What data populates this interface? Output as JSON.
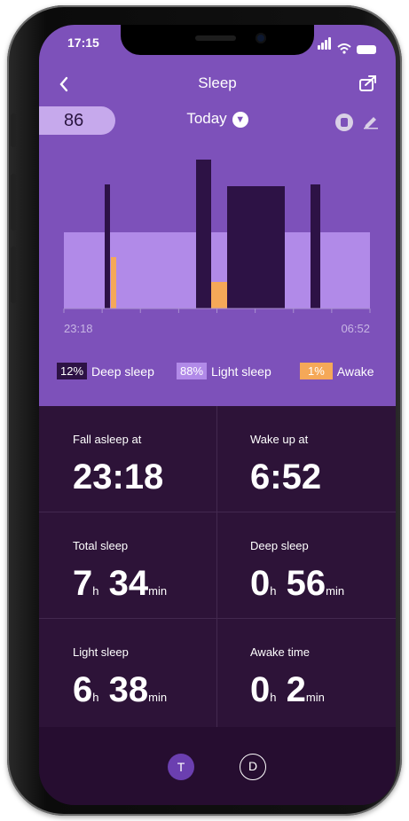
{
  "status": {
    "time": "17:15"
  },
  "header": {
    "title": "Sleep"
  },
  "score": "86",
  "date_selector": {
    "label": "Today"
  },
  "chart": {
    "start_label": "23:18",
    "end_label": "06:52"
  },
  "chart_data": {
    "type": "timeline",
    "start": "23:18",
    "end": "06:52",
    "stages": [
      "Light",
      "Deep",
      "Light",
      "Awake",
      "Light",
      "Deep",
      "Awake",
      "Deep",
      "Light",
      "Deep",
      "Light"
    ],
    "colors": {
      "deep": "#2d1245",
      "light": "#b18ae8",
      "awake": "#f5a858"
    }
  },
  "legend": [
    {
      "pct": "12%",
      "name": "Deep sleep",
      "color": "#2d1245"
    },
    {
      "pct": "88%",
      "name": "Light sleep",
      "color": "#b18ae8"
    },
    {
      "pct": "1%",
      "name": "Awake",
      "color": "#f5a858"
    }
  ],
  "stats": {
    "fall_asleep": {
      "label": "Fall asleep at",
      "value": "23:18"
    },
    "wake_up": {
      "label": "Wake up at",
      "value": "6:52"
    },
    "total_sleep": {
      "label": "Total sleep",
      "h": "7",
      "h_unit": "h",
      "m": "34",
      "m_unit": "min"
    },
    "deep_sleep": {
      "label": "Deep sleep",
      "h": "0",
      "h_unit": "h",
      "m": "56",
      "m_unit": "min"
    },
    "light_sleep": {
      "label": "Light sleep",
      "h": "6",
      "h_unit": "h",
      "m": "38",
      "m_unit": "min"
    },
    "awake_time": {
      "label": "Awake time",
      "h": "0",
      "h_unit": "h",
      "m": "2",
      "m_unit": "min"
    }
  },
  "tabs": [
    {
      "label": "T"
    },
    {
      "label": "D"
    }
  ]
}
